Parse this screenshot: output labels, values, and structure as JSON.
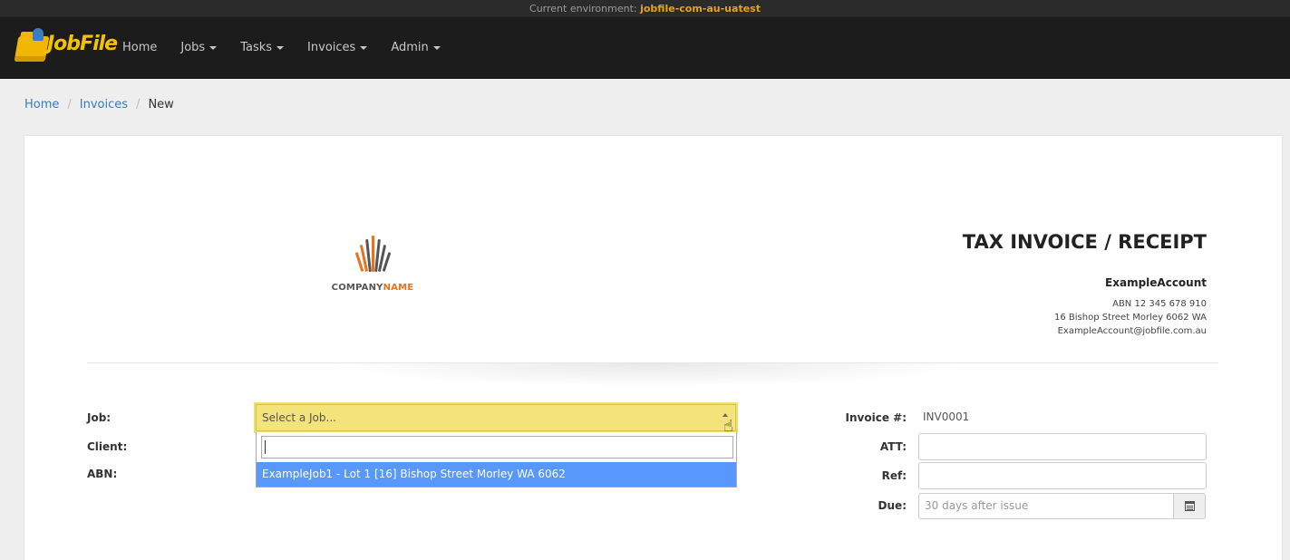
{
  "env": {
    "label": "Current environment:",
    "value": "jobfile-com-au-uatest"
  },
  "brand": {
    "name": "JobFile"
  },
  "nav": {
    "items": [
      "Home",
      "Jobs",
      "Tasks",
      "Invoices",
      "Admin"
    ]
  },
  "breadcrumb": {
    "home": "Home",
    "invoices": "Invoices",
    "current": "New"
  },
  "logo": {
    "part1": "COMPANY",
    "part2": "NAME"
  },
  "invoice": {
    "title": "TAX INVOICE / RECEIPT",
    "account_name": "ExampleAccount",
    "abn": "ABN 12 345 678 910",
    "address": "16 Bishop Street Morley 6062 WA",
    "email": "ExampleAccount@jobfile.com.au"
  },
  "form": {
    "job_label": "Job:",
    "client_label": "Client:",
    "abn_label": "ABN:",
    "job_placeholder": "Select a Job...",
    "job_search_value": "",
    "job_option": "ExampleJob1 - Lot 1 [16] Bishop Street Morley WA 6062",
    "invoice_num_label": "Invoice #:",
    "invoice_num_value": "INV0001",
    "att_label": "ATT:",
    "att_value": "",
    "ref_label": "Ref:",
    "ref_value": "",
    "due_label": "Due:",
    "due_placeholder": "30 days after issue"
  },
  "colors": {
    "brand_yellow": "#f3c300",
    "logo_orange": "#e8731a",
    "highlight_blue": "#5897fb",
    "link_blue": "#3a7ab8"
  }
}
